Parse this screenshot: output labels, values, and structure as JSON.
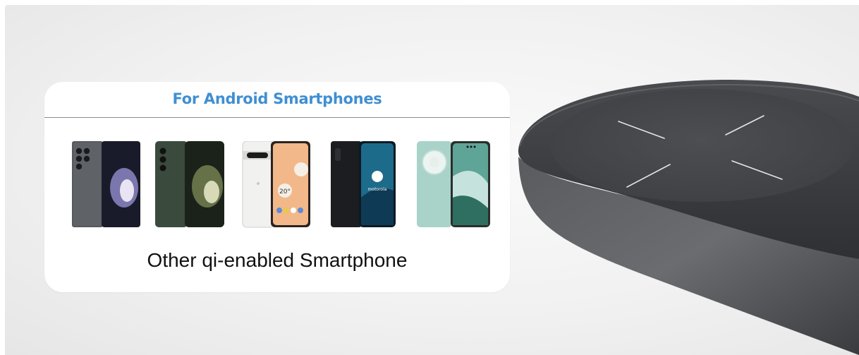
{
  "card": {
    "title": "For Android Smartphones",
    "caption": "Other qi-enabled Smartphone"
  },
  "phones": [
    {
      "model": "samsung-galaxy-s23-ultra",
      "color": "#4a4d52"
    },
    {
      "model": "samsung-galaxy-s23",
      "color": "#3e4a3f"
    },
    {
      "model": "google-pixel-7-pro",
      "color": "#f4f4f2",
      "screen_text": "20°"
    },
    {
      "model": "motorola-edge",
      "color": "#1d1f24",
      "screen_text": "motorola"
    },
    {
      "model": "huawei-mate-60",
      "color": "#9cc9bf"
    }
  ],
  "colors": {
    "title_blue": "#3f8fd2",
    "charger_body": "#3a3b3e",
    "charger_pad": "#48494d"
  }
}
